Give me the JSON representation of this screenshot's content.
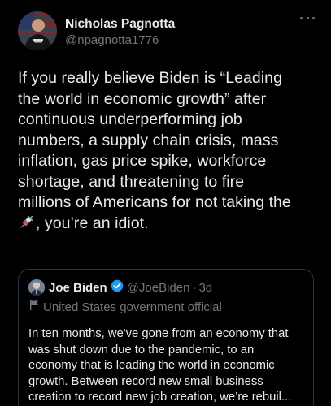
{
  "tweet": {
    "author": {
      "display_name": "Nicholas Pagnotta",
      "handle": "@npagnotta1776",
      "avatar_icon": "profile-photo-flag-background"
    },
    "more_icon": "ellipsis-icon",
    "body_lines": [
      "If you really believe Biden is “Leading",
      "the world in economic growth” after",
      "continuous underperforming job",
      "numbers, a supply chain crisis, mass",
      "inflation, gas price spike, workforce",
      "shortage, and threatening to fire",
      "millions of Americans for not taking the"
    ],
    "last_line_emoji": "syringe-emoji",
    "last_line_text": ", you’re an idiot."
  },
  "quoted_tweet": {
    "display_name": "Joe Biden",
    "verified_icon": "verified-badge-icon",
    "handle": "@JoeBiden",
    "separator": "·",
    "time": "3d",
    "label_icon": "government-flag-icon",
    "label": "United States government official",
    "text_lines": [
      "In ten months, we've gone from an economy that",
      "was shut down due to the pandemic, to an",
      "economy that is leading the world in economic",
      "growth. Between record new small business",
      "creation to record new job creation, we’re rebuil..."
    ]
  },
  "colors": {
    "background": "#000000",
    "primary_text": "#e7e9ea",
    "secondary_text": "#71767b",
    "border": "#2f3336",
    "verified": "#1d9bf0"
  }
}
